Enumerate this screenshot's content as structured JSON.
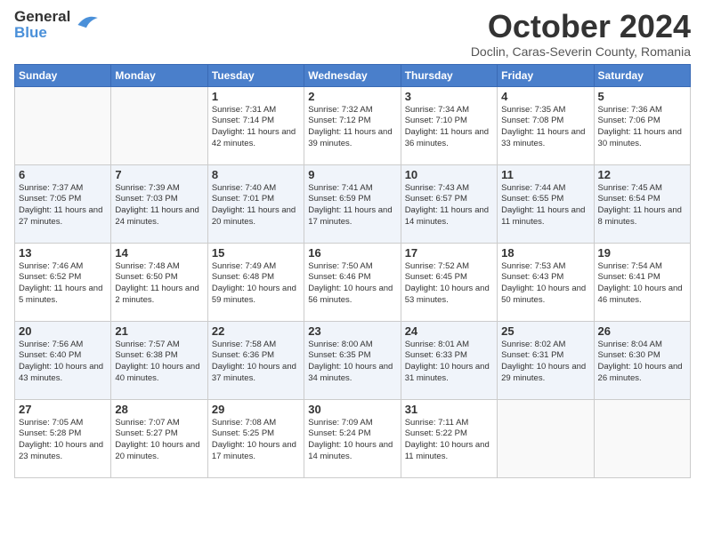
{
  "header": {
    "logo_line1": "General",
    "logo_line2": "Blue",
    "month": "October 2024",
    "location": "Doclin, Caras-Severin County, Romania"
  },
  "days_of_week": [
    "Sunday",
    "Monday",
    "Tuesday",
    "Wednesday",
    "Thursday",
    "Friday",
    "Saturday"
  ],
  "weeks": [
    [
      {
        "day": "",
        "info": ""
      },
      {
        "day": "",
        "info": ""
      },
      {
        "day": "1",
        "info": "Sunrise: 7:31 AM\nSunset: 7:14 PM\nDaylight: 11 hours and 42 minutes."
      },
      {
        "day": "2",
        "info": "Sunrise: 7:32 AM\nSunset: 7:12 PM\nDaylight: 11 hours and 39 minutes."
      },
      {
        "day": "3",
        "info": "Sunrise: 7:34 AM\nSunset: 7:10 PM\nDaylight: 11 hours and 36 minutes."
      },
      {
        "day": "4",
        "info": "Sunrise: 7:35 AM\nSunset: 7:08 PM\nDaylight: 11 hours and 33 minutes."
      },
      {
        "day": "5",
        "info": "Sunrise: 7:36 AM\nSunset: 7:06 PM\nDaylight: 11 hours and 30 minutes."
      }
    ],
    [
      {
        "day": "6",
        "info": "Sunrise: 7:37 AM\nSunset: 7:05 PM\nDaylight: 11 hours and 27 minutes."
      },
      {
        "day": "7",
        "info": "Sunrise: 7:39 AM\nSunset: 7:03 PM\nDaylight: 11 hours and 24 minutes."
      },
      {
        "day": "8",
        "info": "Sunrise: 7:40 AM\nSunset: 7:01 PM\nDaylight: 11 hours and 20 minutes."
      },
      {
        "day": "9",
        "info": "Sunrise: 7:41 AM\nSunset: 6:59 PM\nDaylight: 11 hours and 17 minutes."
      },
      {
        "day": "10",
        "info": "Sunrise: 7:43 AM\nSunset: 6:57 PM\nDaylight: 11 hours and 14 minutes."
      },
      {
        "day": "11",
        "info": "Sunrise: 7:44 AM\nSunset: 6:55 PM\nDaylight: 11 hours and 11 minutes."
      },
      {
        "day": "12",
        "info": "Sunrise: 7:45 AM\nSunset: 6:54 PM\nDaylight: 11 hours and 8 minutes."
      }
    ],
    [
      {
        "day": "13",
        "info": "Sunrise: 7:46 AM\nSunset: 6:52 PM\nDaylight: 11 hours and 5 minutes."
      },
      {
        "day": "14",
        "info": "Sunrise: 7:48 AM\nSunset: 6:50 PM\nDaylight: 11 hours and 2 minutes."
      },
      {
        "day": "15",
        "info": "Sunrise: 7:49 AM\nSunset: 6:48 PM\nDaylight: 10 hours and 59 minutes."
      },
      {
        "day": "16",
        "info": "Sunrise: 7:50 AM\nSunset: 6:46 PM\nDaylight: 10 hours and 56 minutes."
      },
      {
        "day": "17",
        "info": "Sunrise: 7:52 AM\nSunset: 6:45 PM\nDaylight: 10 hours and 53 minutes."
      },
      {
        "day": "18",
        "info": "Sunrise: 7:53 AM\nSunset: 6:43 PM\nDaylight: 10 hours and 50 minutes."
      },
      {
        "day": "19",
        "info": "Sunrise: 7:54 AM\nSunset: 6:41 PM\nDaylight: 10 hours and 46 minutes."
      }
    ],
    [
      {
        "day": "20",
        "info": "Sunrise: 7:56 AM\nSunset: 6:40 PM\nDaylight: 10 hours and 43 minutes."
      },
      {
        "day": "21",
        "info": "Sunrise: 7:57 AM\nSunset: 6:38 PM\nDaylight: 10 hours and 40 minutes."
      },
      {
        "day": "22",
        "info": "Sunrise: 7:58 AM\nSunset: 6:36 PM\nDaylight: 10 hours and 37 minutes."
      },
      {
        "day": "23",
        "info": "Sunrise: 8:00 AM\nSunset: 6:35 PM\nDaylight: 10 hours and 34 minutes."
      },
      {
        "day": "24",
        "info": "Sunrise: 8:01 AM\nSunset: 6:33 PM\nDaylight: 10 hours and 31 minutes."
      },
      {
        "day": "25",
        "info": "Sunrise: 8:02 AM\nSunset: 6:31 PM\nDaylight: 10 hours and 29 minutes."
      },
      {
        "day": "26",
        "info": "Sunrise: 8:04 AM\nSunset: 6:30 PM\nDaylight: 10 hours and 26 minutes."
      }
    ],
    [
      {
        "day": "27",
        "info": "Sunrise: 7:05 AM\nSunset: 5:28 PM\nDaylight: 10 hours and 23 minutes."
      },
      {
        "day": "28",
        "info": "Sunrise: 7:07 AM\nSunset: 5:27 PM\nDaylight: 10 hours and 20 minutes."
      },
      {
        "day": "29",
        "info": "Sunrise: 7:08 AM\nSunset: 5:25 PM\nDaylight: 10 hours and 17 minutes."
      },
      {
        "day": "30",
        "info": "Sunrise: 7:09 AM\nSunset: 5:24 PM\nDaylight: 10 hours and 14 minutes."
      },
      {
        "day": "31",
        "info": "Sunrise: 7:11 AM\nSunset: 5:22 PM\nDaylight: 10 hours and 11 minutes."
      },
      {
        "day": "",
        "info": ""
      },
      {
        "day": "",
        "info": ""
      }
    ]
  ]
}
